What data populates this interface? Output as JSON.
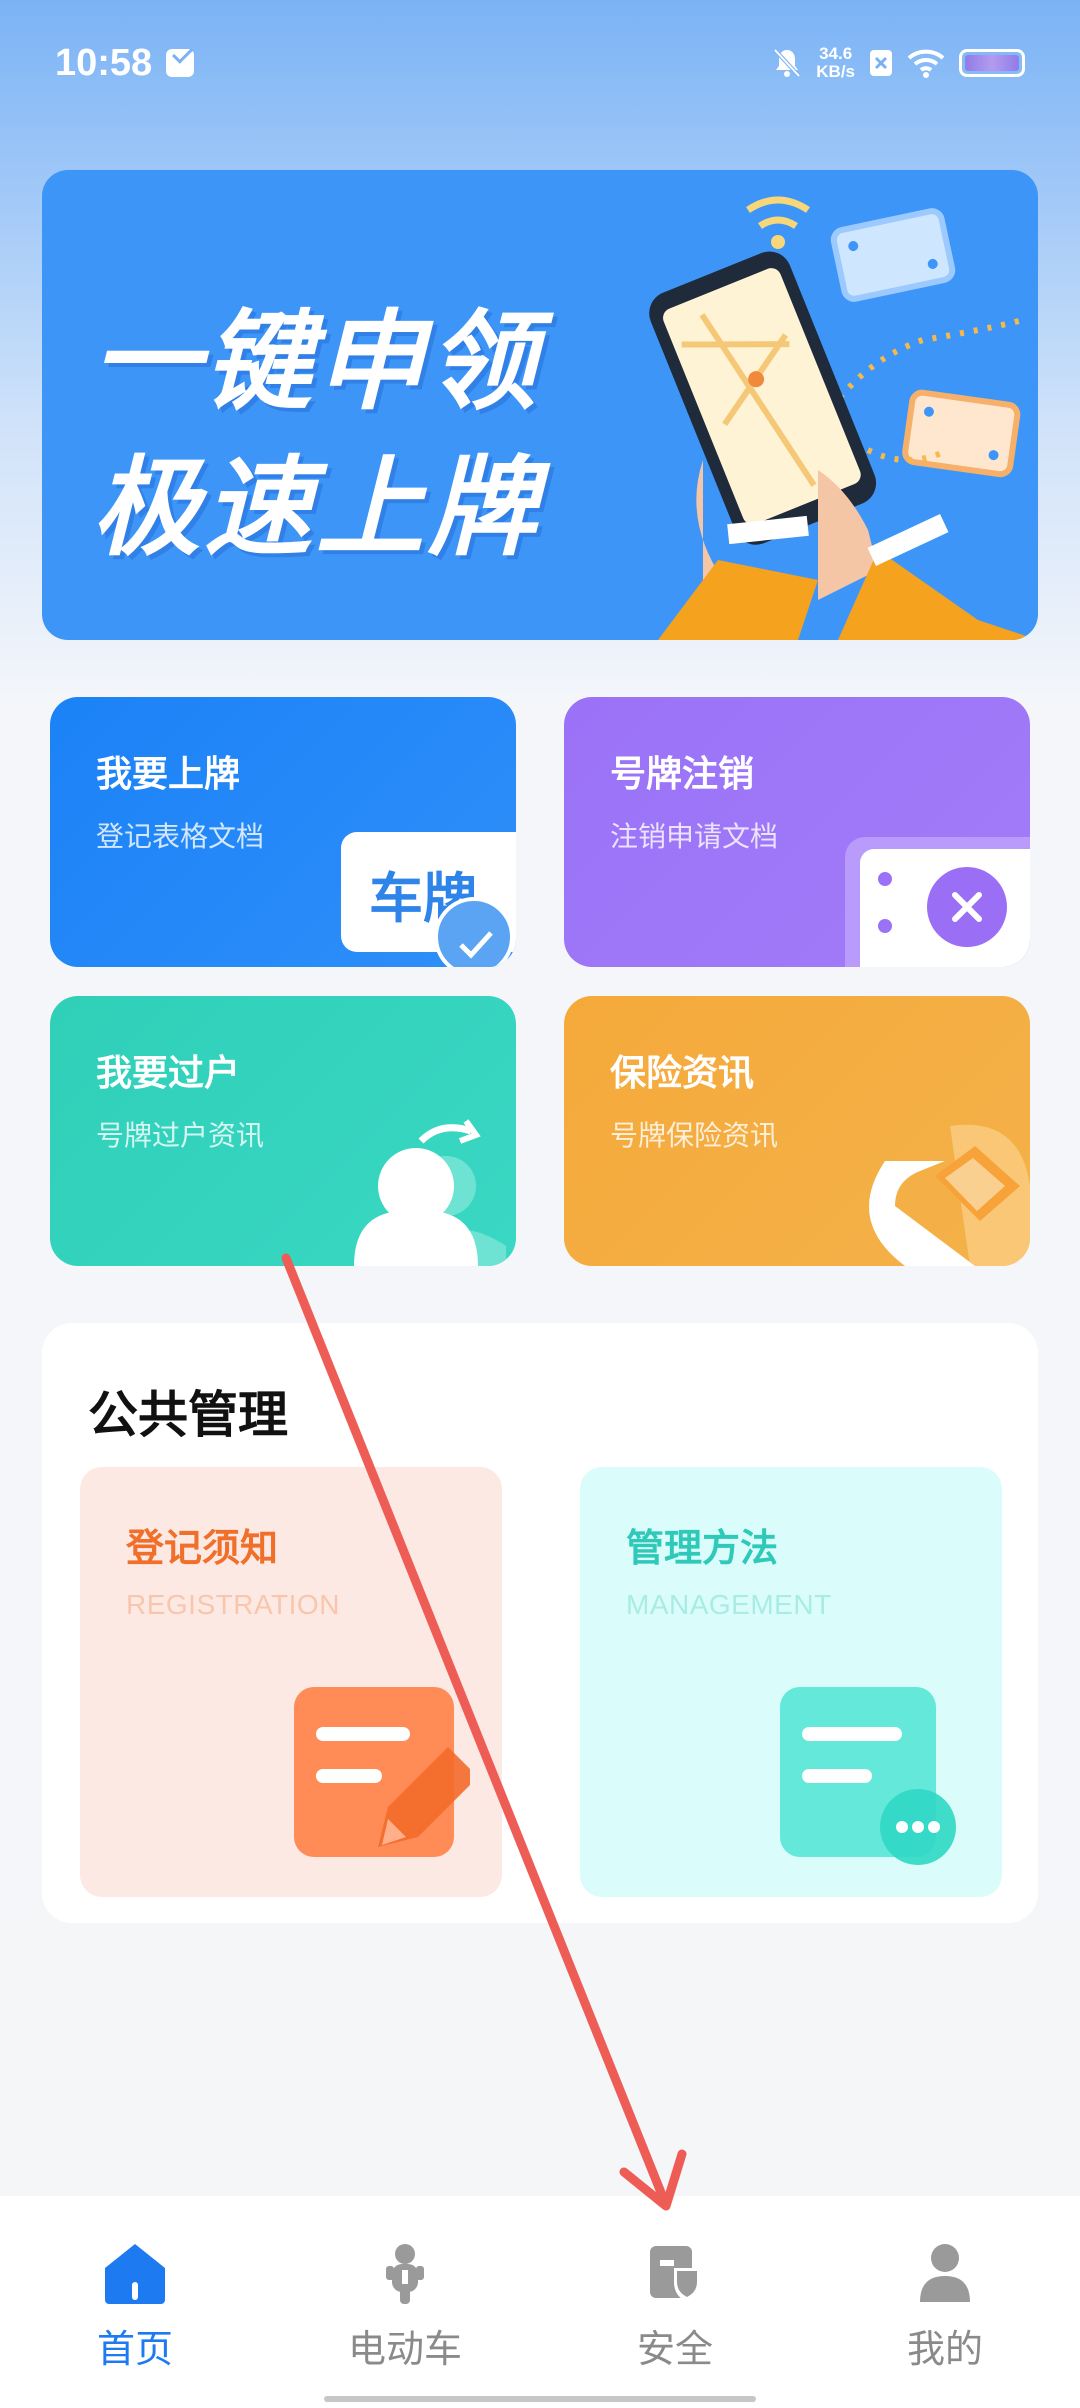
{
  "status_bar": {
    "time": "10:58",
    "speed_value": "34.6",
    "speed_unit": "KB/s"
  },
  "banner": {
    "line1": "一键申领",
    "line2": "极速上牌"
  },
  "tiles": [
    {
      "title": "我要上牌",
      "subtitle": "登记表格文档",
      "badge": "车牌",
      "color": "#1b82f7"
    },
    {
      "title": "号牌注销",
      "subtitle": "注销申请文档",
      "color": "#9b72f7"
    },
    {
      "title": "我要过户",
      "subtitle": "号牌过户资讯",
      "color": "#2fcfb8"
    },
    {
      "title": "保险资讯",
      "subtitle": "号牌保险资讯",
      "color": "#f5a93a"
    }
  ],
  "public": {
    "title": "公共管理",
    "cards": [
      {
        "title": "登记须知",
        "subtitle": "REGISTRATION",
        "color": "#f06f2a"
      },
      {
        "title": "管理方法",
        "subtitle": "MANAGEMENT",
        "color": "#2ec9b8"
      }
    ]
  },
  "tabbar": {
    "items": [
      {
        "label": "首页",
        "icon": "home-icon",
        "active": true
      },
      {
        "label": "电动车",
        "icon": "scooter-icon",
        "active": false
      },
      {
        "label": "安全",
        "icon": "shield-document-icon",
        "active": false
      },
      {
        "label": "我的",
        "icon": "person-icon",
        "active": false
      }
    ],
    "active_color": "#1e7af0",
    "inactive_color": "#8a8a8a"
  }
}
